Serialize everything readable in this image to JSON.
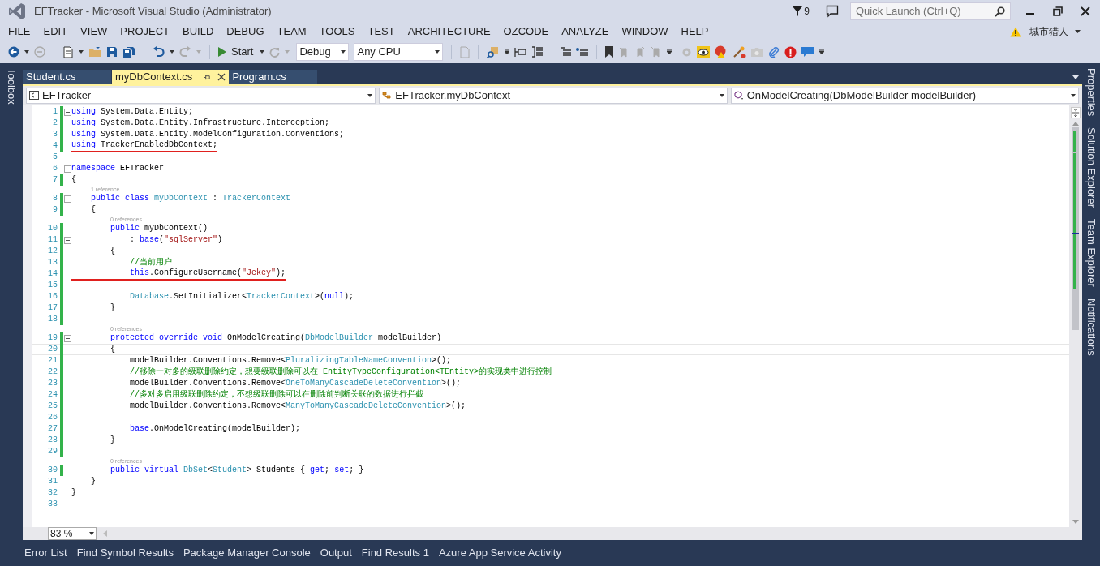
{
  "window": {
    "title": "EFTracker - Microsoft Visual Studio (Administrator)",
    "notifications_count": "9",
    "quick_launch": {
      "placeholder": "Quick Launch (Ctrl+Q)"
    },
    "user": "城市猎人"
  },
  "menu": [
    "FILE",
    "EDIT",
    "VIEW",
    "PROJECT",
    "BUILD",
    "DEBUG",
    "TEAM",
    "TOOLS",
    "TEST",
    "ARCHITECTURE",
    "OZCODE",
    "ANALYZE",
    "WINDOW",
    "HELP"
  ],
  "toolbar": {
    "start": "Start",
    "configuration": "Debug",
    "platform": "Any CPU"
  },
  "left_rail": [
    "Toolbox"
  ],
  "right_rail": [
    "Properties",
    "Solution Explorer",
    "Team Explorer",
    "Notifications"
  ],
  "tabs": [
    {
      "label": "Student.cs",
      "selected": false
    },
    {
      "label": "myDbContext.cs",
      "selected": true
    },
    {
      "label": "Program.cs",
      "selected": false
    }
  ],
  "navigation": [
    "EFTracker",
    "EFTracker.myDbContext",
    "OnModelCreating(DbModelBuilder modelBuilder)"
  ],
  "code_lines": [
    {
      "number": "1",
      "changed": true,
      "fold": true,
      "tokens": [
        {
          "kind": "kw",
          "text": "using"
        },
        {
          "kind": "plain",
          "text": " System.Data.Entity;"
        }
      ]
    },
    {
      "number": "2",
      "changed": true,
      "tokens": [
        {
          "kind": "kw",
          "text": "using"
        },
        {
          "kind": "plain",
          "text": " System.Data.Entity.Infrastructure.Interception;"
        }
      ]
    },
    {
      "number": "3",
      "changed": true,
      "tokens": [
        {
          "kind": "kw",
          "text": "using"
        },
        {
          "kind": "plain",
          "text": " System.Data.Entity.ModelConfiguration.Conventions;"
        }
      ]
    },
    {
      "number": "4",
      "changed": true,
      "underlined": true,
      "tokens": [
        {
          "kind": "kw",
          "text": "using"
        },
        {
          "kind": "plain",
          "text": " TrackerEnabledDbContext;"
        }
      ]
    },
    {
      "number": "5",
      "changed": false
    },
    {
      "number": "6",
      "changed": false,
      "fold": true,
      "tokens": [
        {
          "kind": "kw",
          "text": "namespace"
        },
        {
          "kind": "plain",
          "text": " EFTracker"
        }
      ]
    },
    {
      "number": "7",
      "changed": true,
      "tokens": [
        {
          "kind": "plain",
          "text": "{"
        }
      ]
    },
    {
      "number": "8",
      "changed": true,
      "fold": true,
      "lens": "1 reference",
      "tokens": [
        {
          "kind": "kw",
          "text": "    public class "
        },
        {
          "kind": "type",
          "text": "myDbContext"
        },
        {
          "kind": "plain",
          "text": " : "
        },
        {
          "kind": "type",
          "text": "TrackerContext"
        }
      ]
    },
    {
      "number": "9",
      "changed": true,
      "tokens": [
        {
          "kind": "plain",
          "text": "    {"
        }
      ]
    },
    {
      "number": "10",
      "changed": true,
      "lens": "0 references",
      "tokens": [
        {
          "kind": "kw",
          "text": "        public"
        },
        {
          "kind": "plain",
          "text": " myDbContext()"
        }
      ]
    },
    {
      "number": "11",
      "changed": true,
      "fold": true,
      "tokens": [
        {
          "kind": "plain",
          "text": "            : "
        },
        {
          "kind": "kw",
          "text": "base"
        },
        {
          "kind": "plain",
          "text": "("
        },
        {
          "kind": "str",
          "text": "\"sqlServer\""
        },
        {
          "kind": "plain",
          "text": ")"
        }
      ]
    },
    {
      "number": "12",
      "changed": true,
      "tokens": [
        {
          "kind": "plain",
          "text": "        {"
        }
      ]
    },
    {
      "number": "13",
      "changed": true,
      "tokens": [
        {
          "kind": "comment",
          "text": "            //当前用户"
        }
      ]
    },
    {
      "number": "14",
      "changed": true,
      "underlined": true,
      "tokens": [
        {
          "kind": "kw",
          "text": "            this"
        },
        {
          "kind": "plain",
          "text": ".ConfigureUsername("
        },
        {
          "kind": "str",
          "text": "\"Jekey\""
        },
        {
          "kind": "plain",
          "text": ");"
        }
      ]
    },
    {
      "number": "15",
      "changed": true
    },
    {
      "number": "16",
      "changed": true,
      "tokens": [
        {
          "kind": "type",
          "text": "            Database"
        },
        {
          "kind": "plain",
          "text": ".SetInitializer<"
        },
        {
          "kind": "type",
          "text": "TrackerContext"
        },
        {
          "kind": "plain",
          "text": ">("
        },
        {
          "kind": "kw",
          "text": "null"
        },
        {
          "kind": "plain",
          "text": ");"
        }
      ]
    },
    {
      "number": "17",
      "changed": true,
      "tokens": [
        {
          "kind": "plain",
          "text": "        }"
        }
      ]
    },
    {
      "number": "18",
      "changed": true
    },
    {
      "number": "19",
      "changed": true,
      "fold": true,
      "lens": "0 references",
      "tokens": [
        {
          "kind": "kw",
          "text": "        protected override void"
        },
        {
          "kind": "plain",
          "text": " OnModelCreating("
        },
        {
          "kind": "type",
          "text": "DbModelBuilder"
        },
        {
          "kind": "plain",
          "text": " modelBuilder)"
        }
      ]
    },
    {
      "number": "20",
      "changed": true,
      "current": true,
      "tokens": [
        {
          "kind": "plain",
          "text": "        {"
        }
      ]
    },
    {
      "number": "21",
      "changed": true,
      "tokens": [
        {
          "kind": "plain",
          "text": "            modelBuilder.Conventions.Remove<"
        },
        {
          "kind": "type",
          "text": "PluralizingTableNameConvention"
        },
        {
          "kind": "plain",
          "text": ">();"
        }
      ]
    },
    {
      "number": "22",
      "changed": true,
      "tokens": [
        {
          "kind": "comment",
          "text": "            //移除一对多的级联删除约定，想要级联删除可以在 EntityTypeConfiguration<TEntity>的实现类中进行控制"
        }
      ]
    },
    {
      "number": "23",
      "changed": true,
      "tokens": [
        {
          "kind": "plain",
          "text": "            modelBuilder.Conventions.Remove<"
        },
        {
          "kind": "type",
          "text": "OneToManyCascadeDeleteConvention"
        },
        {
          "kind": "plain",
          "text": ">();"
        }
      ]
    },
    {
      "number": "24",
      "changed": true,
      "tokens": [
        {
          "kind": "comment",
          "text": "            //多对多启用级联删除约定，不想级联删除可以在删除前判断关联的数据进行拦截"
        }
      ]
    },
    {
      "number": "25",
      "changed": true,
      "tokens": [
        {
          "kind": "plain",
          "text": "            modelBuilder.Conventions.Remove<"
        },
        {
          "kind": "type",
          "text": "ManyToManyCascadeDeleteConvention"
        },
        {
          "kind": "plain",
          "text": ">();"
        }
      ]
    },
    {
      "number": "26",
      "changed": true
    },
    {
      "number": "27",
      "changed": true,
      "tokens": [
        {
          "kind": "kw",
          "text": "            base"
        },
        {
          "kind": "plain",
          "text": ".OnModelCreating(modelBuilder);"
        }
      ]
    },
    {
      "number": "28",
      "changed": true,
      "tokens": [
        {
          "kind": "plain",
          "text": "        }"
        }
      ]
    },
    {
      "number": "29",
      "changed": true
    },
    {
      "number": "30",
      "changed": true,
      "lens": "0 references",
      "tokens": [
        {
          "kind": "kw",
          "text": "        public virtual "
        },
        {
          "kind": "type",
          "text": "DbSet"
        },
        {
          "kind": "plain",
          "text": "<"
        },
        {
          "kind": "type",
          "text": "Student"
        },
        {
          "kind": "plain",
          "text": "> Students { "
        },
        {
          "kind": "kw",
          "text": "get"
        },
        {
          "kind": "plain",
          "text": "; "
        },
        {
          "kind": "kw",
          "text": "set"
        },
        {
          "kind": "plain",
          "text": "; }"
        }
      ]
    },
    {
      "number": "31",
      "changed": false,
      "tokens": [
        {
          "kind": "plain",
          "text": "    }"
        }
      ]
    },
    {
      "number": "32",
      "changed": false,
      "tokens": [
        {
          "kind": "plain",
          "text": "}"
        }
      ]
    },
    {
      "number": "33",
      "changed": false
    }
  ],
  "zoom": "83 %",
  "bottom_tabs": [
    "Error List",
    "Find Symbol Results",
    "Package Manager Console",
    "Output",
    "Find Results 1",
    "Azure App Service Activity"
  ]
}
